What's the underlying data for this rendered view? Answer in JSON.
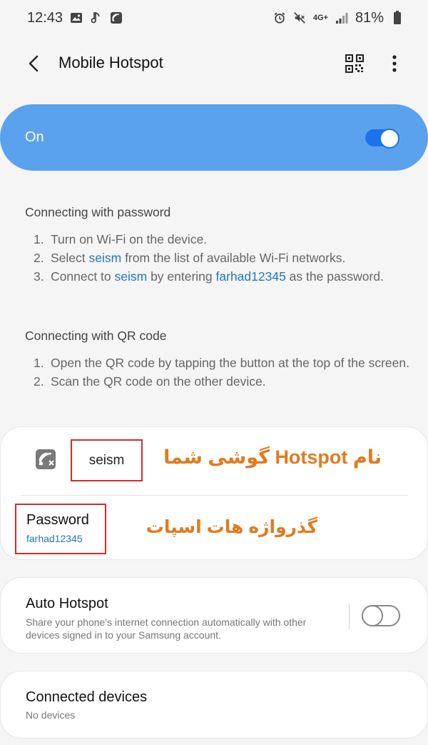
{
  "status_bar": {
    "time": "12:43",
    "battery": "81%",
    "network_label": "4G+",
    "left_icons": [
      "image-icon",
      "music-note-icon",
      "cast-icon"
    ],
    "right_icons": [
      "alarm-icon",
      "mute-icon",
      "signal-icon",
      "battery-icon"
    ]
  },
  "app_bar": {
    "title": "Mobile Hotspot",
    "icons": [
      "back-arrow-icon",
      "qr-code-icon",
      "more-vertical-icon"
    ]
  },
  "master_toggle": {
    "label": "On",
    "state": true,
    "accent_color": "#5aa1ee"
  },
  "password_section": {
    "heading": "Connecting with password",
    "steps": [
      {
        "num": "1.",
        "parts": [
          {
            "text": "Turn on Wi-Fi on the device.",
            "hl": false
          }
        ]
      },
      {
        "num": "2.",
        "parts": [
          {
            "text": "Select ",
            "hl": false
          },
          {
            "text": "seism",
            "hl": true
          },
          {
            "text": " from the list of available Wi-Fi networks.",
            "hl": false
          }
        ]
      },
      {
        "num": "3.",
        "parts": [
          {
            "text": "Connect to ",
            "hl": false
          },
          {
            "text": "seism",
            "hl": true
          },
          {
            "text": " by entering ",
            "hl": false
          },
          {
            "text": "farhad12345",
            "hl": true
          },
          {
            "text": " as the password.",
            "hl": false
          }
        ]
      }
    ]
  },
  "qr_section": {
    "heading": "Connecting with QR code",
    "steps": [
      {
        "num": "1.",
        "parts": [
          {
            "text": "Open the QR code by tapping the button at the top of the screen.",
            "hl": false
          }
        ]
      },
      {
        "num": "2.",
        "parts": [
          {
            "text": "Scan the QR code on the other device.",
            "hl": false
          }
        ]
      }
    ]
  },
  "hotspot_card": {
    "ssid": "seism",
    "ssid_annotation": "نام Hotspot گوشی شما",
    "password_label": "Password",
    "password_value": "farhad12345",
    "password_annotation": "گذرواژه هات اسپات",
    "annotation_color": "#e07b1f",
    "highlight_box_color": "#d62b2b"
  },
  "auto_hotspot": {
    "title": "Auto Hotspot",
    "description": "Share your phone's internet connection automatically with other devices signed in to your Samsung account.",
    "state": false
  },
  "connected_devices": {
    "title": "Connected devices",
    "subtitle": "No devices"
  }
}
